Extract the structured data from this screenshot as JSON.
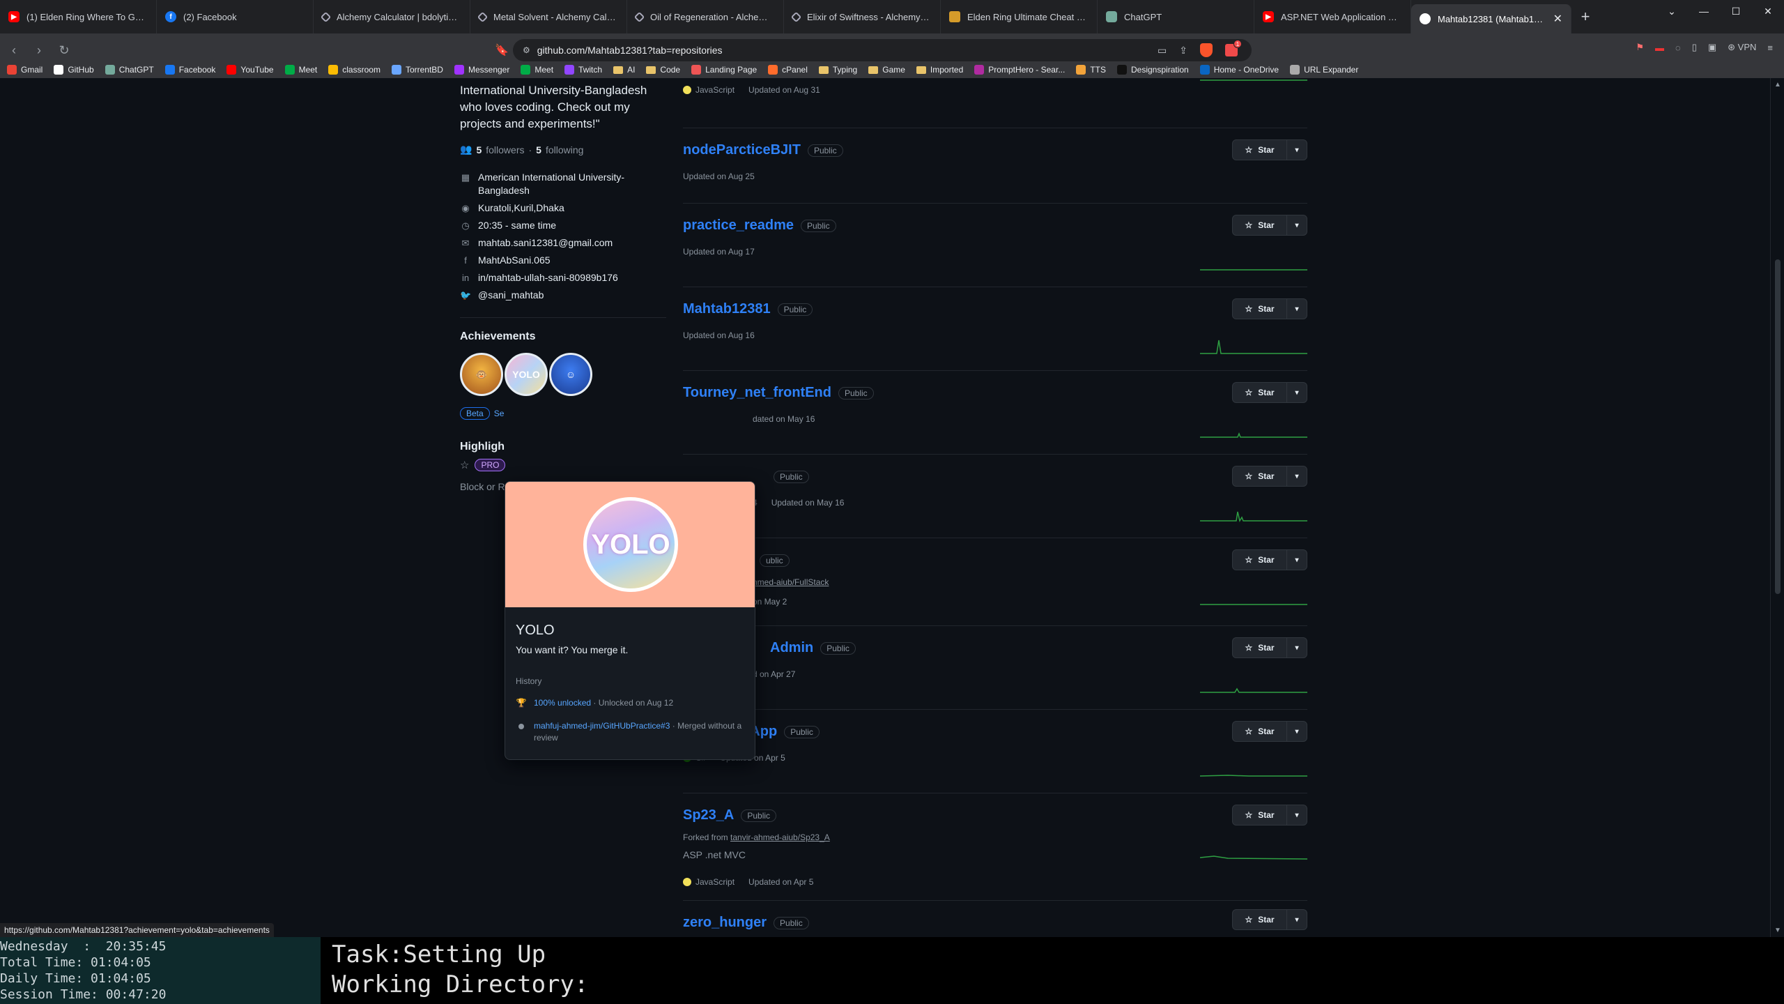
{
  "browser": {
    "tabs": [
      {
        "label": "(1) Elden Ring Where To Go First |",
        "icon": "fav-yt"
      },
      {
        "label": "(2) Facebook",
        "icon": "fav-fb"
      },
      {
        "label": "Alchemy Calculator | bdolytics - Th",
        "icon": "fav-alc"
      },
      {
        "label": "Metal Solvent - Alchemy Calculato",
        "icon": "fav-alc"
      },
      {
        "label": "Oil of Regeneration - Alchemy Cal",
        "icon": "fav-alc"
      },
      {
        "label": "Elixir of Swiftness - Alchemy Calcu",
        "icon": "fav-alc"
      },
      {
        "label": "Elden Ring Ultimate Cheat Engine",
        "icon": "fav-cheat"
      },
      {
        "label": "ChatGPT",
        "icon": "fav-gpt"
      },
      {
        "label": "ASP.NET Web Application Tutorial",
        "icon": "fav-yt"
      }
    ],
    "active_tab": "Mahtab12381 (Mahtab12381)",
    "url": "github.com/Mahtab12381?tab=repositories",
    "vpn_label": "VPN",
    "bookmarks": [
      {
        "label": "Gmail",
        "color": "#ea4335"
      },
      {
        "label": "GitHub",
        "color": "#ffffff"
      },
      {
        "label": "ChatGPT",
        "color": "#74aa9c"
      },
      {
        "label": "Facebook",
        "color": "#1877f2"
      },
      {
        "label": "YouTube",
        "color": "#ff0000"
      },
      {
        "label": "Meet",
        "color": "#00ac47"
      },
      {
        "label": "classroom",
        "color": "#fbbc04"
      },
      {
        "label": "TorrentBD",
        "color": "#6aa6ff"
      },
      {
        "label": "Messenger",
        "color": "#a033ff"
      },
      {
        "label": "Meet",
        "color": "#00ac47"
      },
      {
        "label": "Twitch",
        "color": "#9146ff"
      },
      {
        "label": "AI",
        "folder": true
      },
      {
        "label": "Code",
        "folder": true
      },
      {
        "label": "Landing Page",
        "color": "#e55"
      },
      {
        "label": "cPanel",
        "color": "#ff6c2c"
      },
      {
        "label": "Typing",
        "folder": true
      },
      {
        "label": "Game",
        "folder": true
      },
      {
        "label": "Imported",
        "folder": true
      },
      {
        "label": "PromptHero - Sear...",
        "color": "#b02ba0"
      },
      {
        "label": "TTS",
        "color": "#f2a33a"
      },
      {
        "label": "Designspiration",
        "color": "#111111"
      },
      {
        "label": "Home - OneDrive",
        "color": "#0a66c2"
      },
      {
        "label": "URL Expander",
        "color": "#aaaaaa"
      }
    ],
    "status_url": "https://github.com/Mahtab12381?achievement=yolo&tab=achievements"
  },
  "profile": {
    "bio": "International University-Bangladesh who loves coding. Check out my projects and experiments!\"",
    "followers": "5",
    "followers_label": "followers",
    "following": "5",
    "following_label": "following",
    "details": [
      {
        "icon": "organization-icon",
        "glyph": "▦",
        "text": "American International University-Bangladesh"
      },
      {
        "icon": "location-icon",
        "glyph": "◉",
        "text": "Kuratoli,Kuril,Dhaka"
      },
      {
        "icon": "clock-icon",
        "glyph": "◷",
        "text": "20:35 - same time"
      },
      {
        "icon": "mail-icon",
        "glyph": "✉",
        "text": "mahtab.sani12381@gmail.com"
      },
      {
        "icon": "facebook-icon",
        "glyph": "f",
        "text": "MahtAbSani.065"
      },
      {
        "icon": "linkedin-icon",
        "glyph": "in",
        "text": "in/mahtab-ullah-sani-80989b176"
      },
      {
        "icon": "twitter-icon",
        "glyph": "🐦",
        "text": "@sani_mahtab"
      }
    ],
    "achievements_title": "Achievements",
    "beta_label": "Beta",
    "beta_link": "Se",
    "highlights_title": "Highligh",
    "pro_label": "PRO",
    "block_text": "Block or R"
  },
  "popover": {
    "title": "YOLO",
    "subtitle": "You want it? You merge it.",
    "history_label": "History",
    "item1_link": "100% unlocked",
    "item1_text": " · Unlocked on Aug 12",
    "item2_link": "mahfuj-ahmed-jim/GitHUbPractice#3",
    "item2_text": " · Merged without a review",
    "badge_text": "YOLO"
  },
  "repos": [
    {
      "name": "",
      "visibility": "",
      "lang": "JavaScript",
      "lang_color": "#f1e05a",
      "updated": "Updated on Aug 31"
    },
    {
      "name": "nodeParcticeBJIT",
      "visibility": "Public",
      "updated": "Updated on Aug 25",
      "star": "Star"
    },
    {
      "name": "practice_readme",
      "visibility": "Public",
      "updated": "Updated on Aug 17",
      "star": "Star"
    },
    {
      "name": "Mahtab12381",
      "visibility": "Public",
      "updated": "Updated on Aug 16",
      "star": "Star"
    },
    {
      "name": "Tourney_net_frontEnd",
      "visibility": "Public",
      "updated": "dated on May 16",
      "star": "Star"
    },
    {
      "name": "",
      "visibility": "Public",
      "forks": "4",
      "updated": "Updated on May 16",
      "star": "Star"
    },
    {
      "name": "",
      "visibility": "ublic",
      "forked_text": "hmed-aiub/FullStack",
      "updated": "on May 2",
      "star": "Star"
    },
    {
      "name": "Admin",
      "visibility": "Public",
      "updated": "d on Apr 27",
      "star": "Star"
    },
    {
      "name": "INtro-Tier-App",
      "visibility": "Public",
      "lang": "C#",
      "lang_color": "#178600",
      "updated": "Updated on Apr 5",
      "star": "Star"
    },
    {
      "name": "Sp23_A",
      "visibility": "Public",
      "forked_prefix": "Forked from ",
      "forked_link": "tanvir-ahmed-aiub/Sp23_A",
      "desc": "ASP .net MVC",
      "lang": "JavaScript",
      "lang_color": "#f1e05a",
      "updated": "Updated on Apr 5",
      "star": "Star"
    },
    {
      "name": "zero_hunger",
      "visibility": "Public",
      "star": "Star"
    }
  ],
  "terminal": {
    "left_lines": "Wednesday  :  20:35:45\nTotal Time: 01:04:05\nDaily Time: 01:04:05\nSession Time: 00:47:20",
    "right_lines": "Task:Setting Up\nWorking Directory:"
  },
  "colors": {
    "link": "#2f81f7",
    "bg": "#0d1117",
    "spark": "#2ea043"
  }
}
